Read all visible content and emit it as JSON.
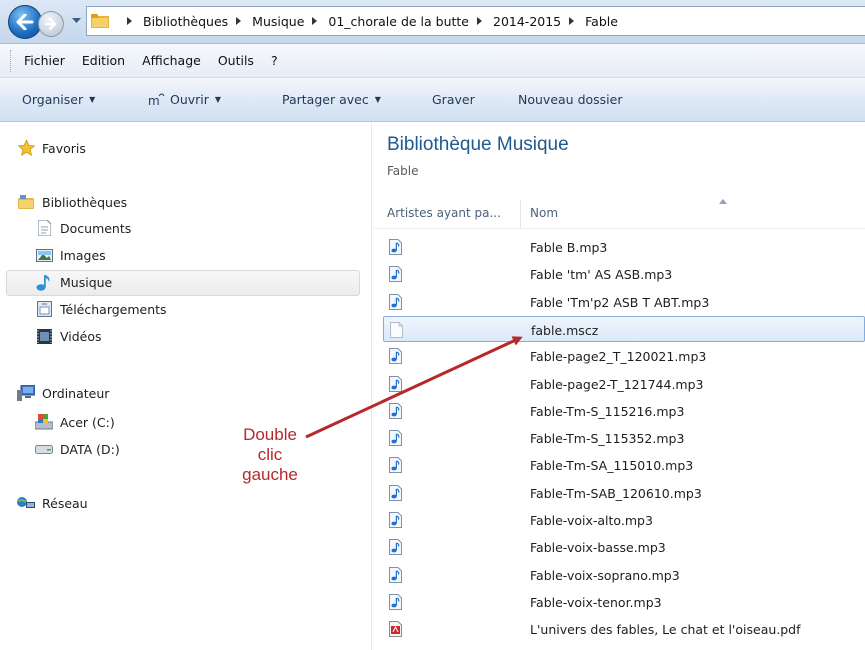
{
  "address": {
    "crumbs": [
      "Bibliothèques",
      "Musique",
      "01_chorale de la butte",
      "2014-2015",
      "Fable"
    ]
  },
  "menu": [
    "Fichier",
    "Edition",
    "Affichage",
    "Outils",
    "?"
  ],
  "toolbar": {
    "organiser": "Organiser",
    "ouvrir": "Ouvrir",
    "partager": "Partager avec",
    "graver": "Graver",
    "nouveau": "Nouveau dossier"
  },
  "nav": {
    "favoris": "Favoris",
    "bibliotheques": "Bibliothèques",
    "documents": "Documents",
    "images": "Images",
    "musique": "Musique",
    "telechargements": "Téléchargements",
    "videos": "Vidéos",
    "ordinateur": "Ordinateur",
    "acer": "Acer (C:)",
    "data": "DATA (D:)",
    "reseau": "Réseau"
  },
  "annotation": [
    "Double",
    "clic",
    "gauche"
  ],
  "content": {
    "title": "Bibliothèque Musique",
    "subtitle": "Fable",
    "col_artistes": "Artistes ayant pa...",
    "col_nom": "Nom",
    "files": [
      {
        "name": "Fable B.mp3",
        "type": "mp3"
      },
      {
        "name": "Fable 'tm' AS ASB.mp3",
        "type": "mp3"
      },
      {
        "name": "Fable 'Tm'p2 ASB T ABT.mp3",
        "type": "mp3"
      },
      {
        "name": "fable.mscz",
        "type": "mscz"
      },
      {
        "name": "Fable-page2_T_120021.mp3",
        "type": "mp3"
      },
      {
        "name": "Fable-page2-T_121744.mp3",
        "type": "mp3"
      },
      {
        "name": "Fable-Tm-S_115216.mp3",
        "type": "mp3"
      },
      {
        "name": "Fable-Tm-S_115352.mp3",
        "type": "mp3"
      },
      {
        "name": "Fable-Tm-SA_115010.mp3",
        "type": "mp3"
      },
      {
        "name": "Fable-Tm-SAB_120610.mp3",
        "type": "mp3"
      },
      {
        "name": "Fable-voix-alto.mp3",
        "type": "mp3"
      },
      {
        "name": "Fable-voix-basse.mp3",
        "type": "mp3"
      },
      {
        "name": "Fable-voix-soprano.mp3",
        "type": "mp3"
      },
      {
        "name": "Fable-voix-tenor.mp3",
        "type": "mp3"
      },
      {
        "name": "L'univers des fables, Le chat et l'oiseau.pdf",
        "type": "pdf"
      }
    ]
  },
  "colors": {
    "title_blue": "#1e5a8e",
    "annotation_red": "#b7282b",
    "selection_border": "#84acdd"
  }
}
